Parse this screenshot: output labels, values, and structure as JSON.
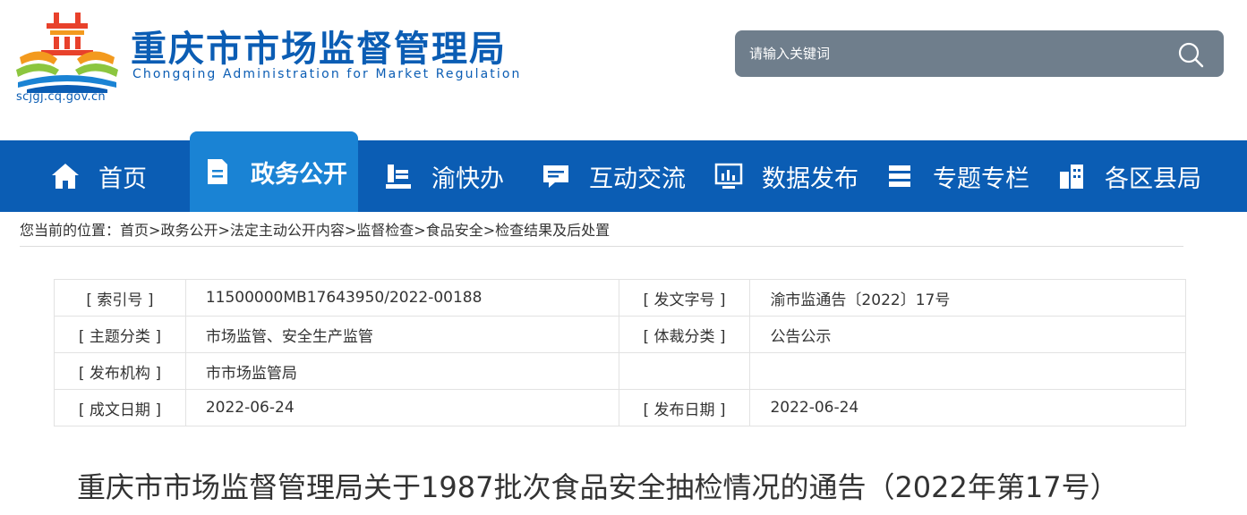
{
  "header": {
    "title": "重庆市市场监督管理局",
    "subtitle": "Chongqing Administration for Market Regulation",
    "domain": "scjgj.cq.gov.cn",
    "brand_blue": "#0b5db4"
  },
  "search": {
    "placeholder": "请输入关键词",
    "icon": "search-icon"
  },
  "nav": {
    "items": [
      {
        "label": "首页",
        "icon": "home-icon"
      },
      {
        "label": "政务公开",
        "icon": "document-icon",
        "active": true
      },
      {
        "label": "渝快办",
        "icon": "book-stack-icon"
      },
      {
        "label": "互动交流",
        "icon": "chat-icon"
      },
      {
        "label": "数据发布",
        "icon": "monitor-chart-icon"
      },
      {
        "label": "专题专栏",
        "icon": "columns-icon"
      },
      {
        "label": "各区县局",
        "icon": "buildings-icon"
      }
    ],
    "bg_color": "#0b5db4",
    "active_color": "#1a83d4"
  },
  "breadcrumb": {
    "prefix": "您当前的位置：",
    "items": [
      "首页",
      "政务公开",
      "法定主动公开内容",
      "监督检查",
      "食品安全",
      "检查结果及后处置"
    ],
    "separator": ">"
  },
  "info": {
    "rows": [
      [
        "[ 索引号 ]",
        "11500000MB17643950/2022-00188",
        "[ 发文字号 ]",
        "渝市监通告〔2022〕17号"
      ],
      [
        "[ 主题分类 ]",
        "市场监管、安全生产监管",
        "[ 体裁分类 ]",
        "公告公示"
      ],
      [
        "[ 发布机构 ]",
        "市市场监管局",
        "",
        ""
      ],
      [
        "[ 成文日期 ]",
        "2022-06-24",
        "[ 发布日期 ]",
        "2022-06-24"
      ]
    ]
  },
  "article": {
    "title": "重庆市市场监督管理局关于1987批次食品安全抽检情况的通告（2022年第17号）"
  }
}
